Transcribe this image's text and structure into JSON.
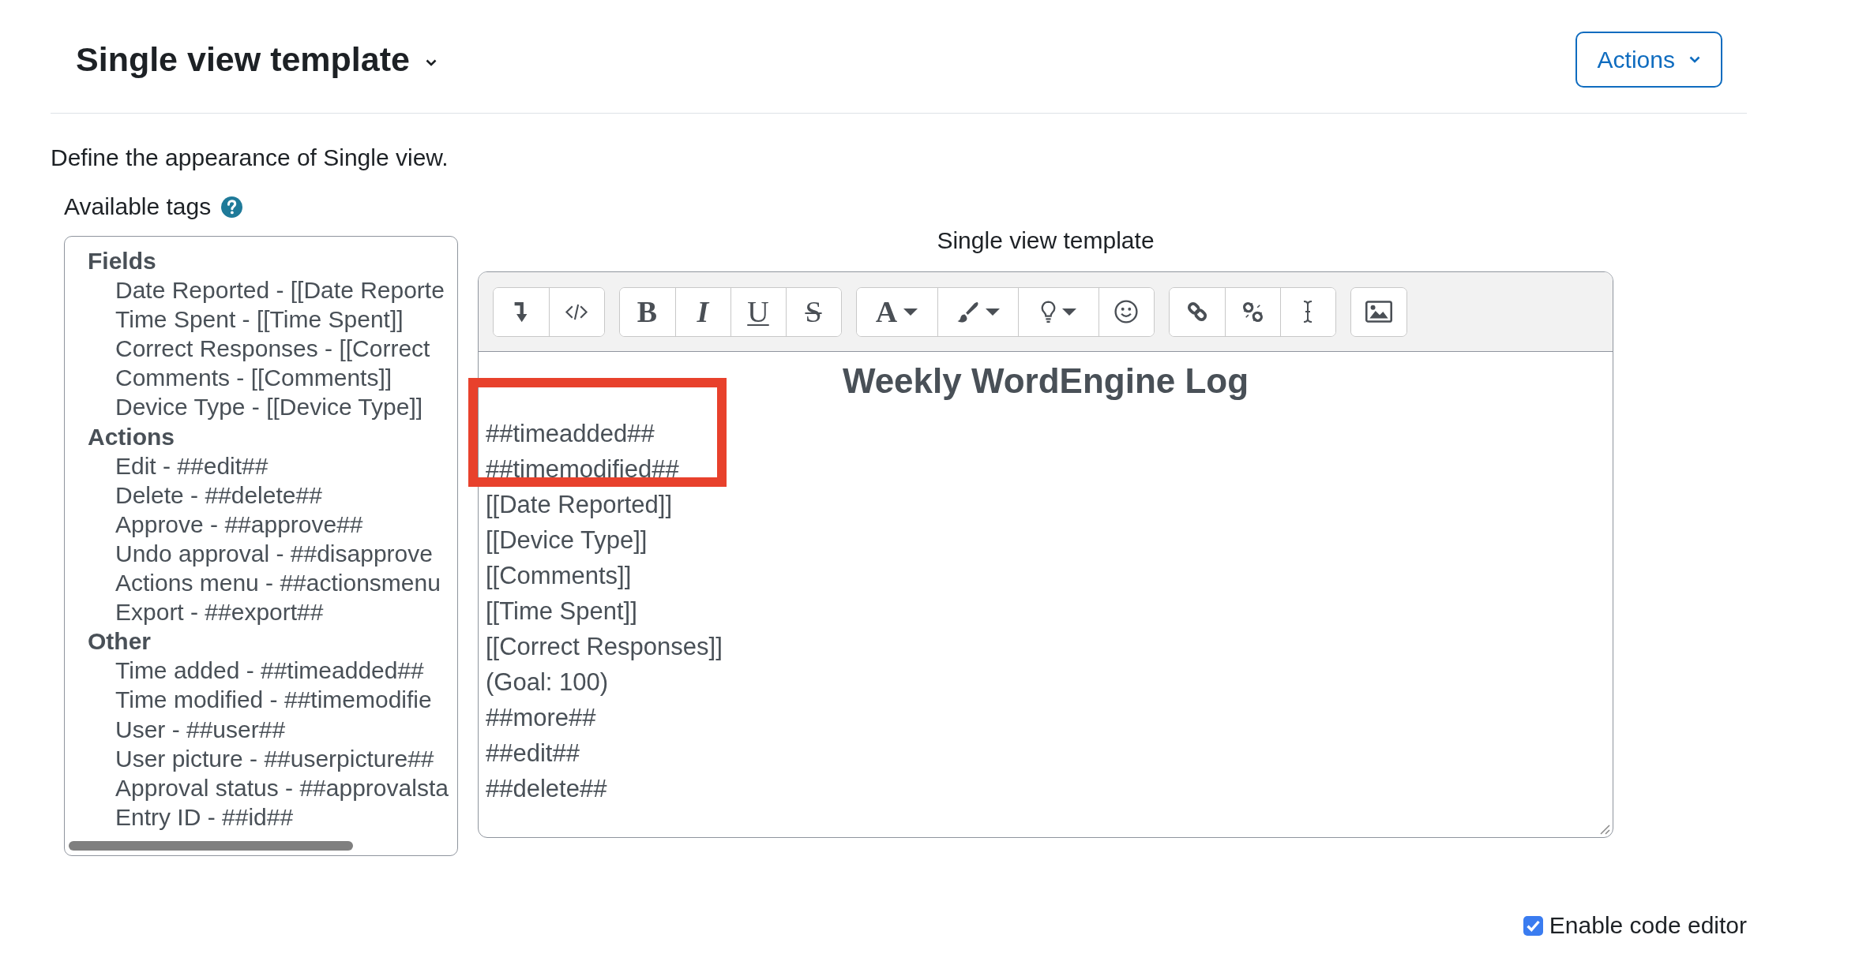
{
  "header": {
    "title": "Single view template",
    "actions_button": "Actions"
  },
  "description": "Define the appearance of Single view.",
  "available_tags": {
    "label": "Available tags",
    "groups": [
      {
        "heading": "Fields",
        "options": [
          {
            "label": "Date Reported - [[Date Reporte",
            "selected": false
          },
          {
            "label": "Time Spent - [[Time Spent]]",
            "selected": false
          },
          {
            "label": "Correct Responses - [[Correct",
            "selected": false
          },
          {
            "label": "Comments - [[Comments]]",
            "selected": false
          },
          {
            "label": "Device Type - [[Device Type]]",
            "selected": false
          }
        ]
      },
      {
        "heading": "Actions",
        "options": [
          {
            "label": "Edit - ##edit##",
            "selected": false
          },
          {
            "label": "Delete - ##delete##",
            "selected": false
          },
          {
            "label": "Approve - ##approve##",
            "selected": false
          },
          {
            "label": "Undo approval - ##disapprove",
            "selected": false
          },
          {
            "label": "Actions menu - ##actionsmenu",
            "selected": false
          },
          {
            "label": "Export - ##export##",
            "selected": false
          }
        ]
      },
      {
        "heading": "Other",
        "options": [
          {
            "label": "Time added - ##timeadded##",
            "selected": false
          },
          {
            "label": "Time modified - ##timemodifie",
            "selected": false
          },
          {
            "label": "User - ##user##",
            "selected": false
          },
          {
            "label": "User picture - ##userpicture##",
            "selected": false
          },
          {
            "label": "Approval status - ##approvalsta",
            "selected": false
          },
          {
            "label": "Entry ID - ##id##",
            "selected": false
          }
        ]
      }
    ]
  },
  "editor": {
    "label": "Single view template",
    "toolbar": [
      [
        {
          "kind": "icon"
        },
        {
          "kind": "icon"
        }
      ],
      [
        {
          "kind": "bold",
          "text": "B"
        },
        {
          "kind": "italic",
          "text": "I"
        },
        {
          "kind": "underline",
          "text": "U"
        },
        {
          "kind": "strikethrough",
          "text": "S"
        }
      ],
      [
        {
          "kind": "text-menu",
          "text": "A"
        },
        {
          "kind": "icon-menu"
        },
        {
          "kind": "icon-menu"
        },
        {
          "kind": "icon"
        }
      ],
      [
        {
          "kind": "icon"
        },
        {
          "kind": "icon"
        },
        {
          "kind": "icon"
        }
      ],
      [
        {
          "kind": "icon"
        }
      ]
    ],
    "heading": "Weekly WordEngine Log",
    "lines": [
      {
        "text": "##timeadded##",
        "highlighted": true
      },
      {
        "text": "##timemodified##",
        "highlighted": true
      },
      {
        "text": "[[Date Reported]]",
        "highlighted": false
      },
      {
        "text": "[[Device Type]]",
        "highlighted": false
      },
      {
        "text": "[[Comments]]",
        "highlighted": false
      },
      {
        "text": "[[Time Spent]]",
        "highlighted": false
      },
      {
        "text": "[[Correct Responses]]",
        "highlighted": false
      },
      {
        "text": "(Goal: 100)",
        "highlighted": false
      },
      {
        "text": "##more##",
        "highlighted": false
      },
      {
        "text": "##edit##",
        "highlighted": false
      },
      {
        "text": "##delete##",
        "highlighted": false
      }
    ]
  },
  "code_editor": {
    "label": "Enable code editor",
    "checked": true
  }
}
